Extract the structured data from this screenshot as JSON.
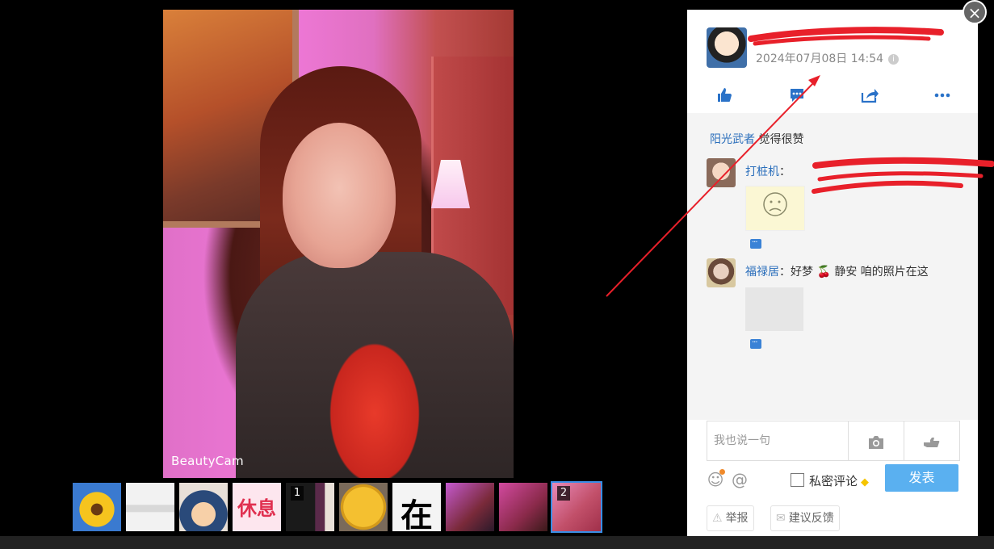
{
  "photo": {
    "watermark": "BeautyCam"
  },
  "thumbnails": [
    {
      "name": "sunflower",
      "badge": "",
      "text": ""
    },
    {
      "name": "cat",
      "badge": "",
      "text": ""
    },
    {
      "name": "cartoon-face",
      "badge": "",
      "text": ""
    },
    {
      "name": "rest-sign",
      "badge": "",
      "text": "休息"
    },
    {
      "name": "dark-photo",
      "badge": "1",
      "text": ""
    },
    {
      "name": "yellow-face",
      "badge": "",
      "text": ""
    },
    {
      "name": "zai-char",
      "badge": "",
      "text": "在"
    },
    {
      "name": "woman-selfie-1",
      "badge": "",
      "text": ""
    },
    {
      "name": "woman-selfie-2",
      "badge": "",
      "text": ""
    },
    {
      "name": "woman-selfie-3",
      "badge": "2",
      "text": "",
      "active": true
    }
  ],
  "post": {
    "username": "",
    "timestamp": "2024年07月08日 14:54"
  },
  "actions": {
    "like": "like-icon",
    "comment": "comment-icon",
    "share": "share-icon",
    "more": "more-icon"
  },
  "likes": {
    "name": "阳光武者",
    "suffix": " 觉得很赞"
  },
  "comments": [
    {
      "who": "打桩机",
      "text": "："
    },
    {
      "who": "福禄居",
      "text": "：好梦 🍒 静安 咱的照片在这"
    }
  ],
  "input": {
    "placeholder": "我也说一句"
  },
  "private_label": "私密评论",
  "submit_label": "发表",
  "footer": {
    "report": "举报",
    "feedback": "建议反馈"
  },
  "colors": {
    "accent": "#2a6ebb",
    "submit": "#5ab0f0",
    "annotation": "#e8202a"
  }
}
